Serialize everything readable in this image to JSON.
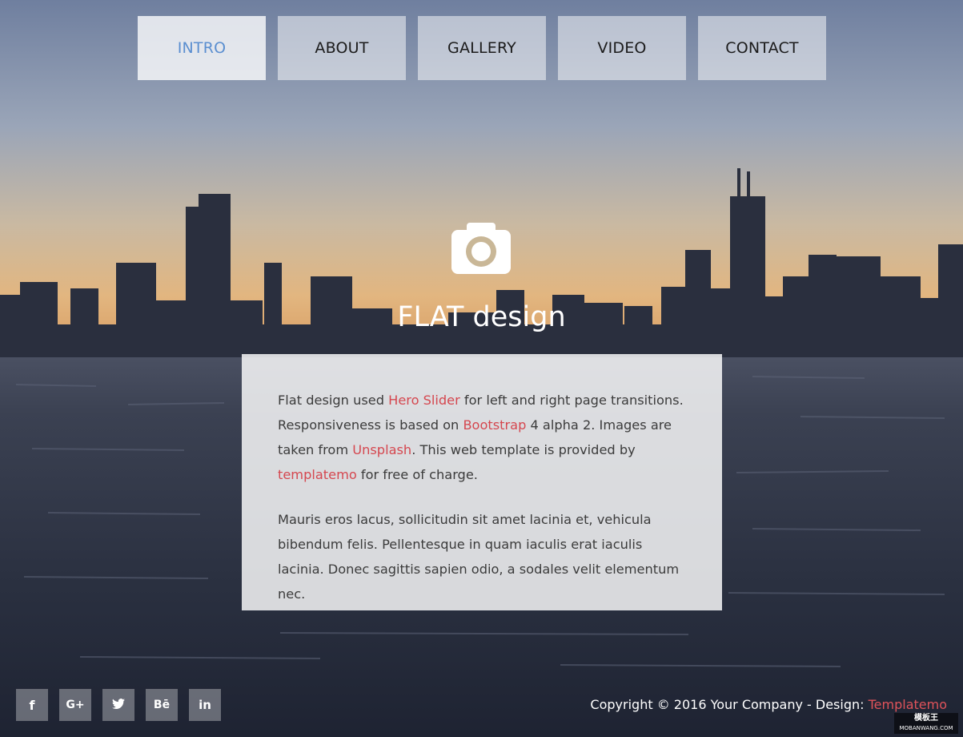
{
  "nav": {
    "items": [
      {
        "label": "INTRO",
        "active": true
      },
      {
        "label": "ABOUT",
        "active": false
      },
      {
        "label": "GALLERY",
        "active": false
      },
      {
        "label": "VIDEO",
        "active": false
      },
      {
        "label": "CONTACT",
        "active": false
      }
    ]
  },
  "hero": {
    "icon": "camera-icon",
    "title": "FLAT design"
  },
  "card": {
    "p1": {
      "t1": "Flat design used ",
      "link1": "Hero Slider",
      "t2": " for left and right page transitions. Responsiveness is based on ",
      "link2": "Bootstrap",
      "t3": " 4 alpha 2. Images are taken from ",
      "link3": "Unsplash",
      "t4": ". This web template is provided by ",
      "link4": "templatemo",
      "t5": " for free of charge."
    },
    "p2": "Mauris eros lacus, sollicitudin sit amet lacinia et, vehicula bibendum felis. Pellentesque in quam iaculis erat iaculis lacinia. Donec sagittis sapien odio, a sodales velit elementum nec."
  },
  "social": {
    "items": [
      {
        "glyph": "f",
        "icon": "facebook-icon"
      },
      {
        "glyph": "G+",
        "icon": "google-plus-icon"
      },
      {
        "glyph": "🐦",
        "icon": "twitter-icon"
      },
      {
        "glyph": "Bē",
        "icon": "behance-icon"
      },
      {
        "glyph": "in",
        "icon": "linkedin-icon"
      }
    ]
  },
  "footer": {
    "copyright_text": "Copyright © 2016 Your Company - Design: ",
    "copyright_link": "Templatemo"
  },
  "watermark": {
    "line1": "模板王",
    "line2": "MOBANWANG.COM"
  },
  "colors": {
    "link": "#d5474f",
    "nav_active_text": "#5b8fd0"
  }
}
